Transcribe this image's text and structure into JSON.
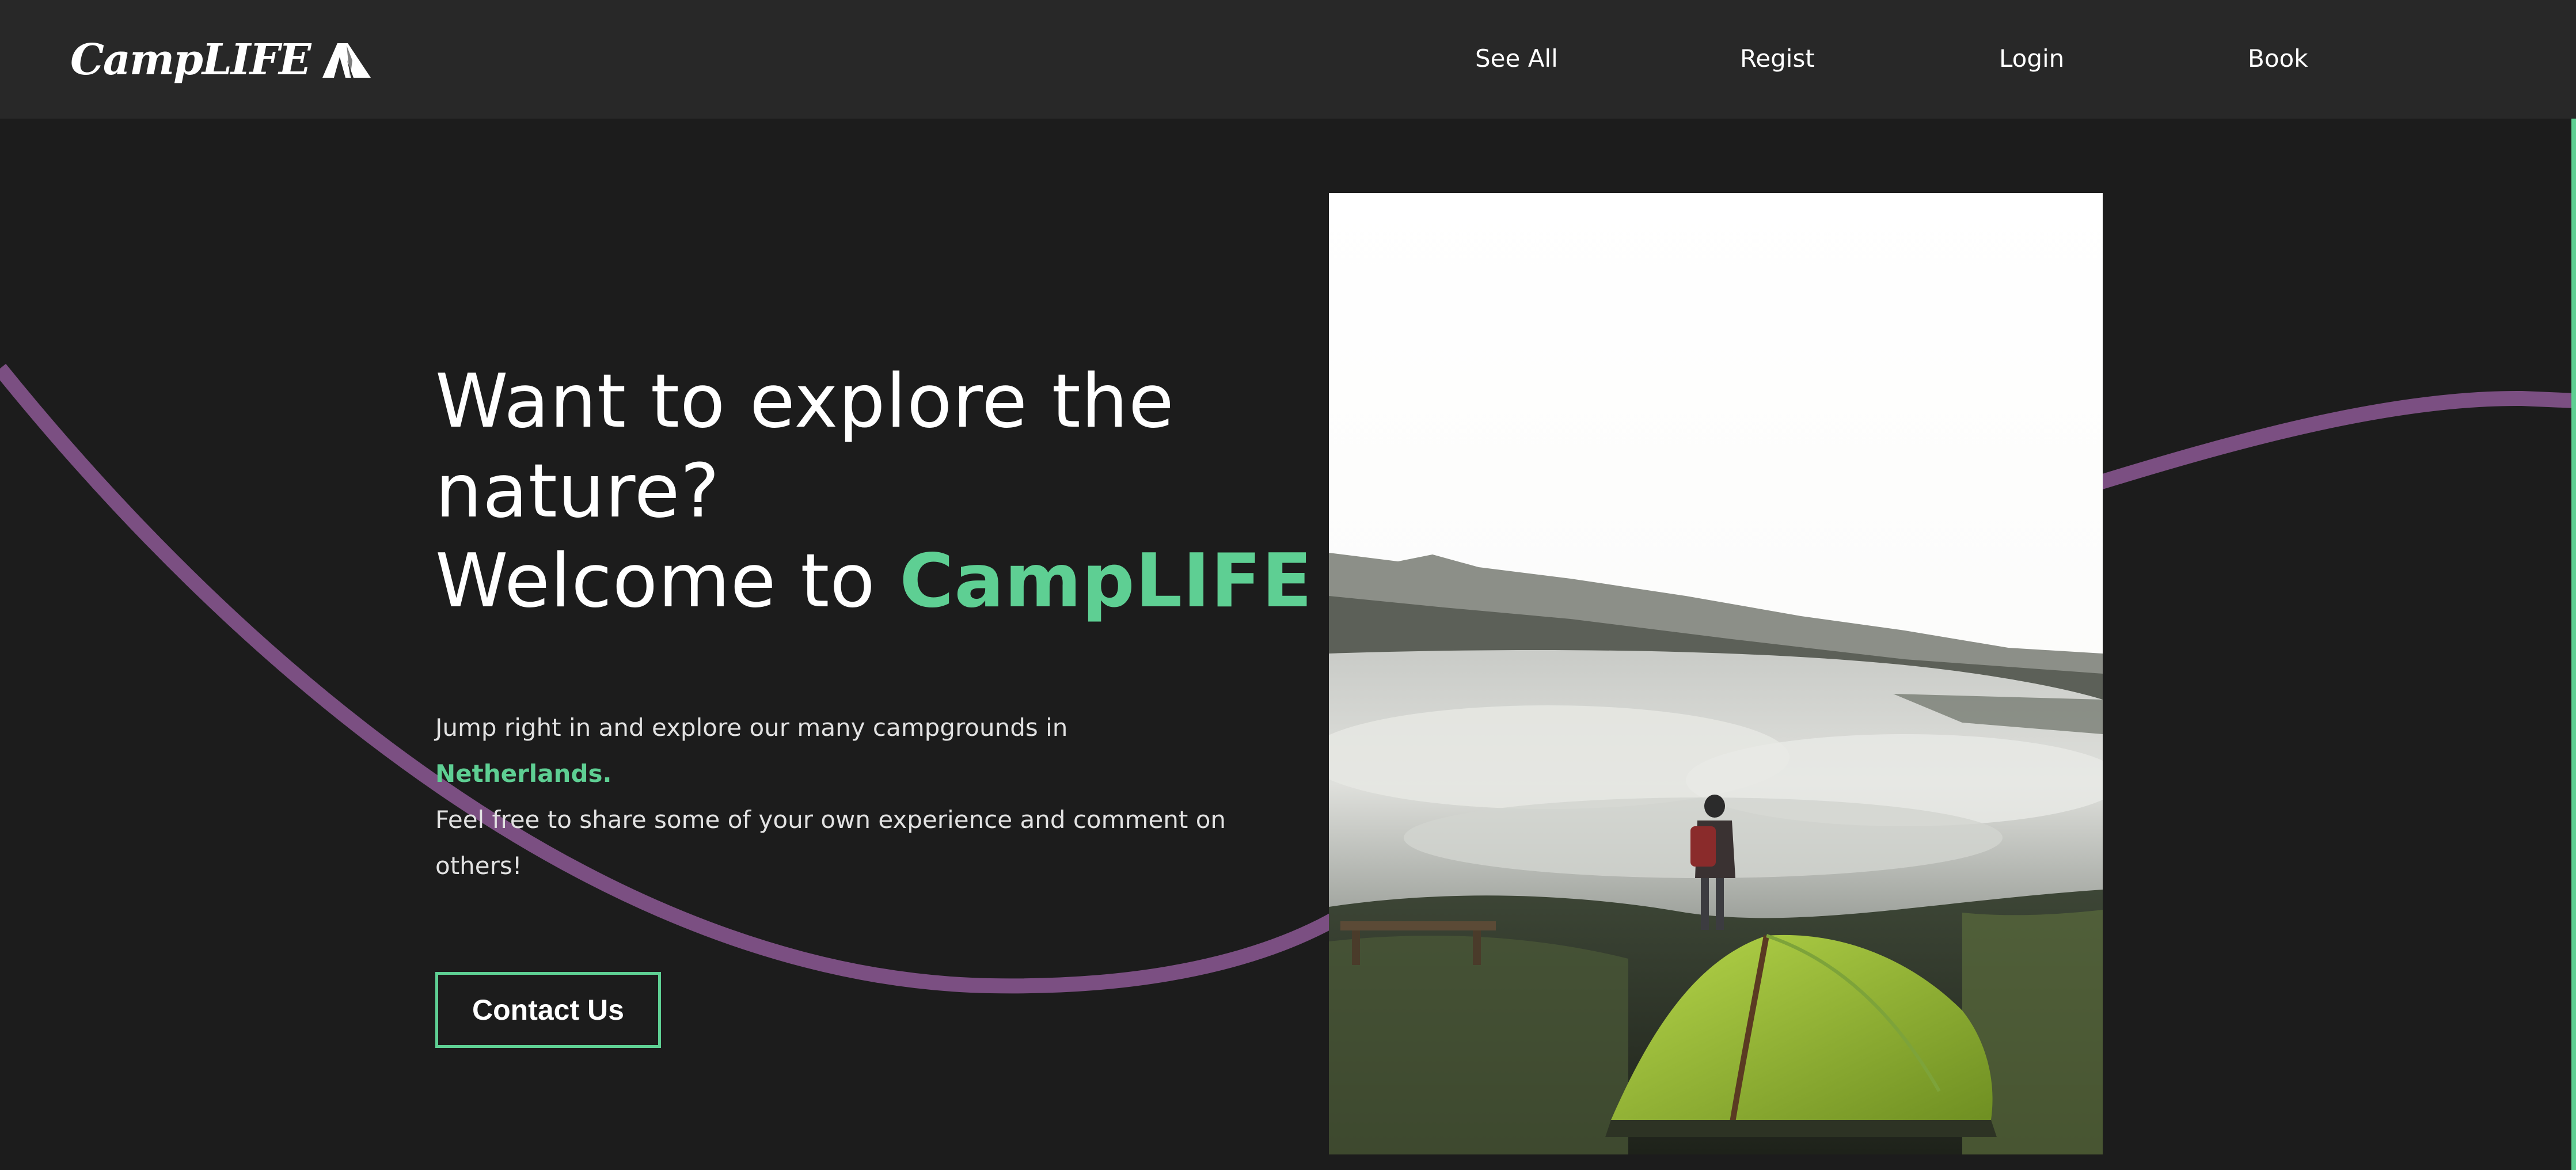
{
  "brand": {
    "name": "CampLIFE",
    "logo_icon": "tent-icon"
  },
  "nav": {
    "items": [
      {
        "label": "See All"
      },
      {
        "label": "Regist"
      },
      {
        "label": "Login"
      },
      {
        "label": "Book"
      }
    ]
  },
  "hero": {
    "title_line1": "Want to explore the",
    "title_line2": "nature?",
    "title_line3_prefix": "Welcome to",
    "title_brand": "CampLIFE",
    "desc_prefix": "Jump right in and explore our many campgrounds in",
    "desc_highlight": "Netherlands.",
    "desc_rest": "Feel free to share some of your own experience and comment on others!",
    "button_label": "Contact Us"
  },
  "colors": {
    "background": "#1c1c1c",
    "navbar": "#282828",
    "accent": "#5ecf93",
    "wave": "#7b4f82",
    "text": "#ffffff"
  }
}
